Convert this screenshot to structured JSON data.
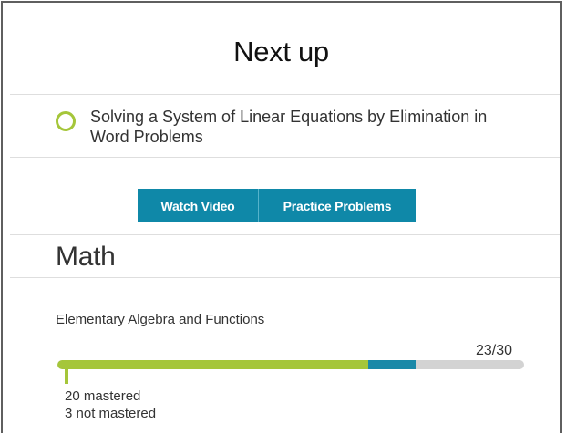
{
  "next_up": {
    "title": "Next up",
    "lesson_title": "Solving a System of Linear Equations by Elimination in Word Problems",
    "status_color": "#a5c63a"
  },
  "actions": {
    "watch_video": "Watch Video",
    "practice_problems": "Practice Problems",
    "button_color": "#0f88a8"
  },
  "subject": {
    "title": "Math"
  },
  "topic": {
    "name": "Elementary Algebra and Functions",
    "progress_label": "23/30",
    "completed": 23,
    "total": 30,
    "mastered_count": 20,
    "not_mastered_count": 3,
    "mastered_text": "20 mastered",
    "not_mastered_text": "3 not mastered",
    "mastered_color": "#a5c63a",
    "not_mastered_color": "#1a89a8",
    "remaining_color": "#d3d3d3"
  }
}
